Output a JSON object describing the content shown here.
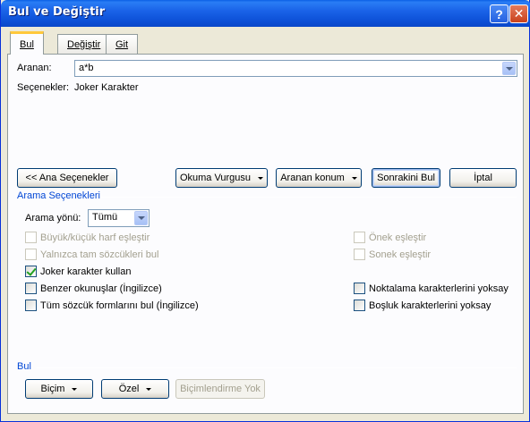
{
  "window": {
    "title": "Bul ve Değiştir"
  },
  "tabs": [
    {
      "label": "Bul",
      "active": true
    },
    {
      "label": "Değiştir",
      "active": false
    },
    {
      "label": "Git",
      "active": false
    }
  ],
  "find": {
    "label": "Aranan:",
    "value": "a*b",
    "options_label": "Seçenekler:",
    "options_value": "Joker Karakter"
  },
  "buttons": {
    "less": "<< Ana Seçenekler",
    "reading_highlight": "Okuma Vurgusu",
    "find_in": "Aranan konum",
    "find_next": "Sonrakini Bul",
    "cancel": "İptal"
  },
  "search_options": {
    "title": "Arama Seçenekleri",
    "direction_label": "Arama yönü:",
    "direction_value": "Tümü",
    "checkboxes": [
      {
        "label": "Büyük/küçük harf eşleştir",
        "checked": false,
        "enabled": false
      },
      {
        "label": "Yalnızca tam sözcükleri bul",
        "checked": false,
        "enabled": false
      },
      {
        "label": "Joker karakter kullan",
        "checked": true,
        "enabled": true
      },
      {
        "label": "Benzer okunuşlar (İngilizce)",
        "checked": false,
        "enabled": true
      },
      {
        "label": "Tüm sözcük formlarını bul (İngilizce)",
        "checked": false,
        "enabled": true
      },
      {
        "label": "Önek eşleştir",
        "checked": false,
        "enabled": false
      },
      {
        "label": "Sonek eşleştir",
        "checked": false,
        "enabled": false
      },
      {
        "label": "Noktalama karakterlerini yoksay",
        "checked": false,
        "enabled": true
      },
      {
        "label": "Boşluk karakterlerini yoksay",
        "checked": false,
        "enabled": true
      }
    ]
  },
  "find_section": {
    "title": "Bul",
    "format": "Biçim",
    "special": "Özel",
    "no_formatting": "Biçimlendirme Yok"
  },
  "colors": {
    "titlebar": "#0A5FE6",
    "accent": "#0046D5",
    "face": "#ECE9D8"
  }
}
